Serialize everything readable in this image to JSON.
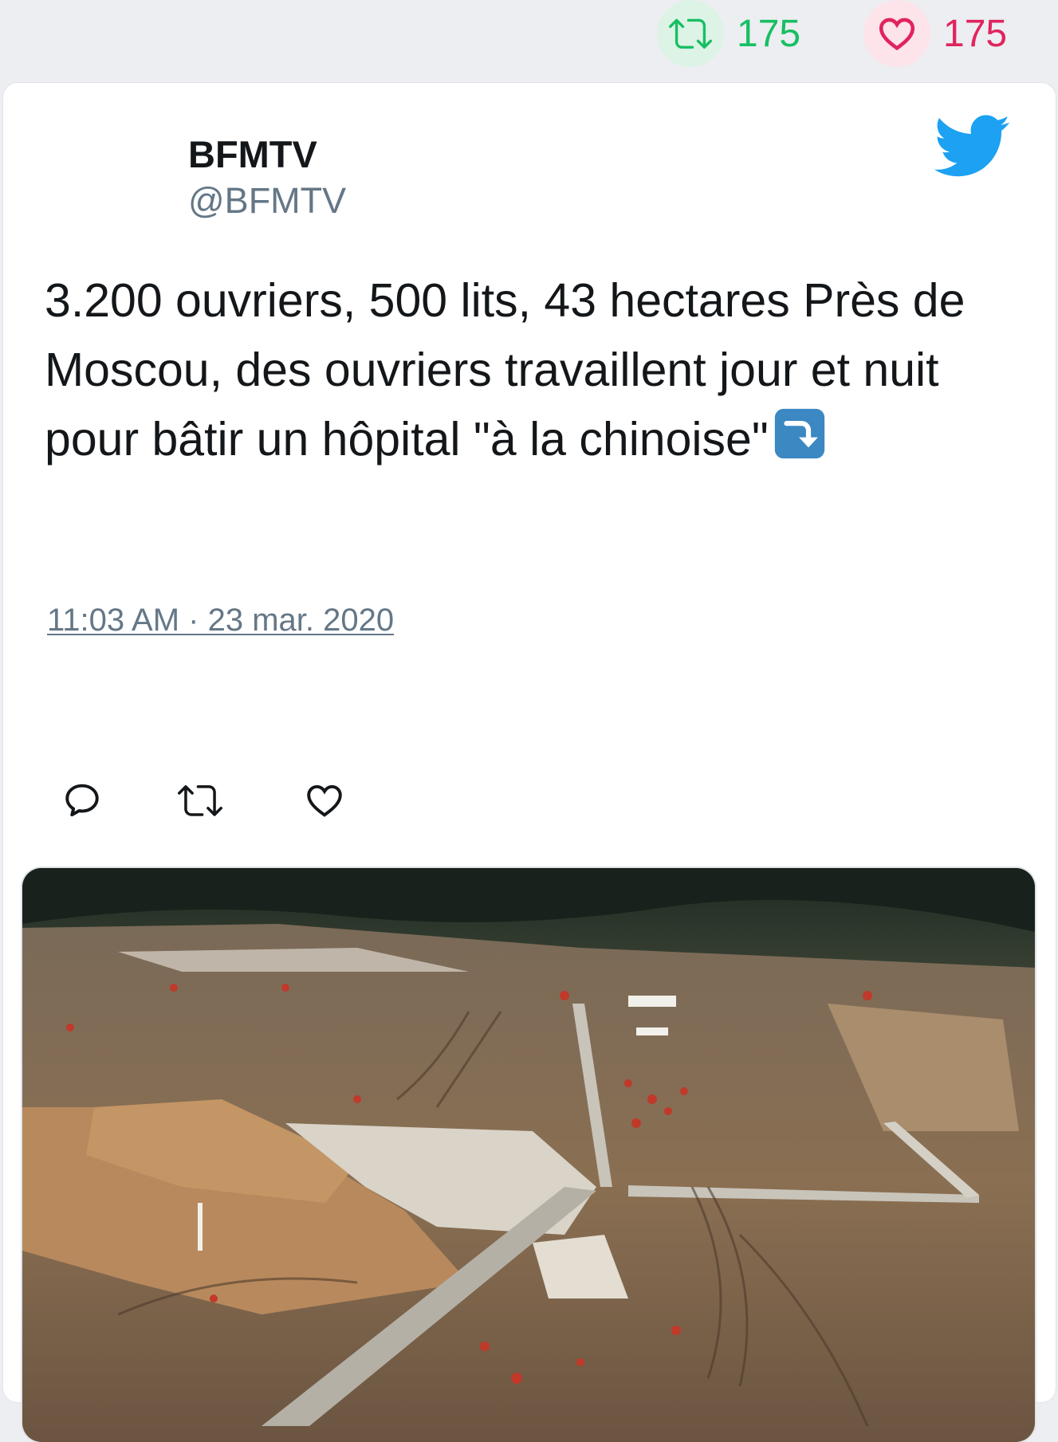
{
  "stats": {
    "retweet_count": "175",
    "like_count": "175",
    "retweet_icon": "retweet-icon",
    "like_icon": "heart-icon",
    "retweet_color": "#17bf63",
    "like_color": "#e0245e"
  },
  "author": {
    "name": "BFMTV",
    "handle": "@BFMTV"
  },
  "brand": {
    "logo": "twitter-bird-icon",
    "color": "#1da1f2"
  },
  "tweet": {
    "text": "3.200 ouvriers, 500 lits, 43 hectares Près de Moscou, des ouvriers travaillent jour et nuit pour bâtir un hôpital \"à la chinoise\"",
    "emoji": "arrow-heading-down-emoji",
    "timestamp": "11:03 AM · 23 mar. 2020"
  },
  "actions": [
    {
      "name": "reply",
      "icon": "reply-icon"
    },
    {
      "name": "retweet",
      "icon": "retweet-icon"
    },
    {
      "name": "like",
      "icon": "heart-icon"
    }
  ],
  "media": {
    "type": "photo",
    "subject": "aerial-construction-site"
  }
}
